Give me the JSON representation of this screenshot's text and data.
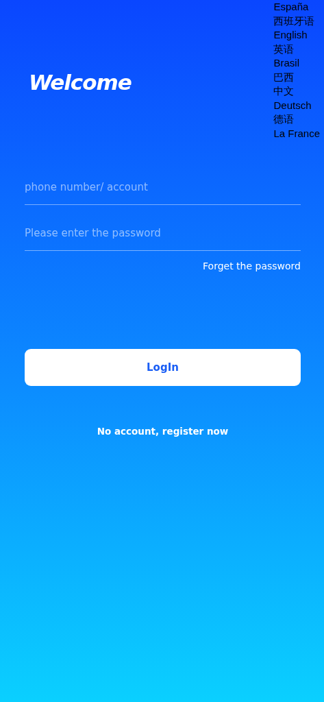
{
  "languages": [
    {
      "label": "España"
    },
    {
      "label": "西班牙语"
    },
    {
      "label": "English"
    },
    {
      "label": "英语"
    },
    {
      "label": "Brasil"
    },
    {
      "label": "巴西"
    },
    {
      "label": "中文"
    },
    {
      "label": "Deutsch"
    },
    {
      "label": "德语"
    },
    {
      "label": "La France"
    }
  ],
  "title": "Welcome",
  "account_field": {
    "placeholder": "phone number/ account"
  },
  "password_field": {
    "placeholder": "Please enter the password"
  },
  "forgot_link": "Forget the password",
  "login_button": "LogIn",
  "register_link": "No account, register now"
}
